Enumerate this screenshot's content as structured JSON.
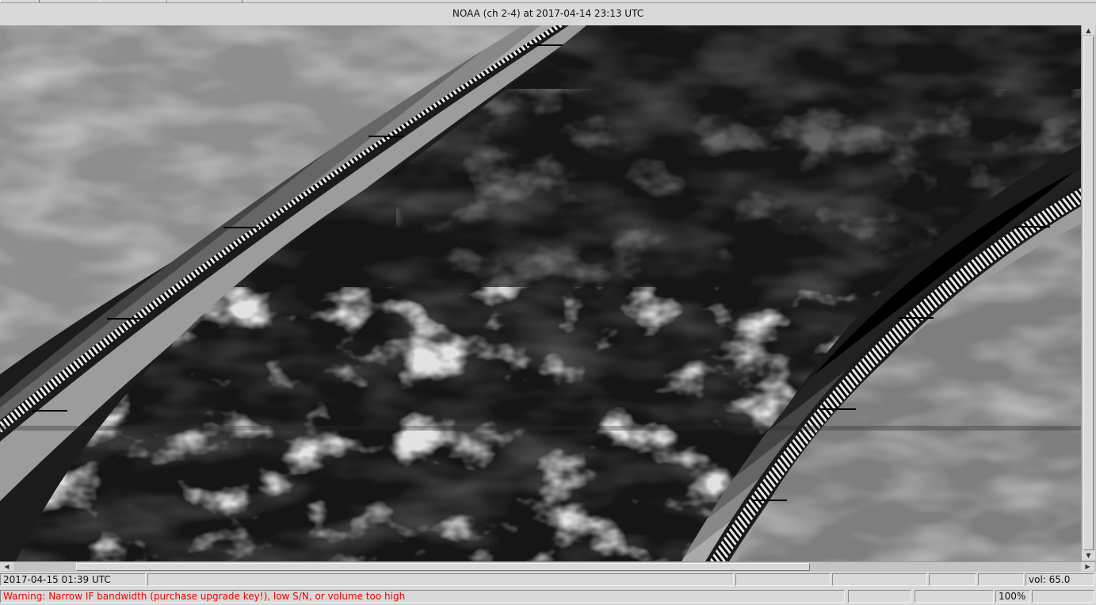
{
  "window": {
    "title": "NOAA (ch 2-4) at 2017-04-14  23:13 UTC"
  },
  "image": {
    "description_icon": "satellite-image"
  },
  "status": {
    "time": "2017-04-15  01:39 UTC",
    "volume": "vol: 65.0",
    "warning": "Warning: Narrow IF bandwidth (purchase upgrade key!), low S/N, or volume too high",
    "zoom": "100%"
  },
  "colors": {
    "warning": "#ee0000",
    "chrome": "#d9d9d9"
  }
}
